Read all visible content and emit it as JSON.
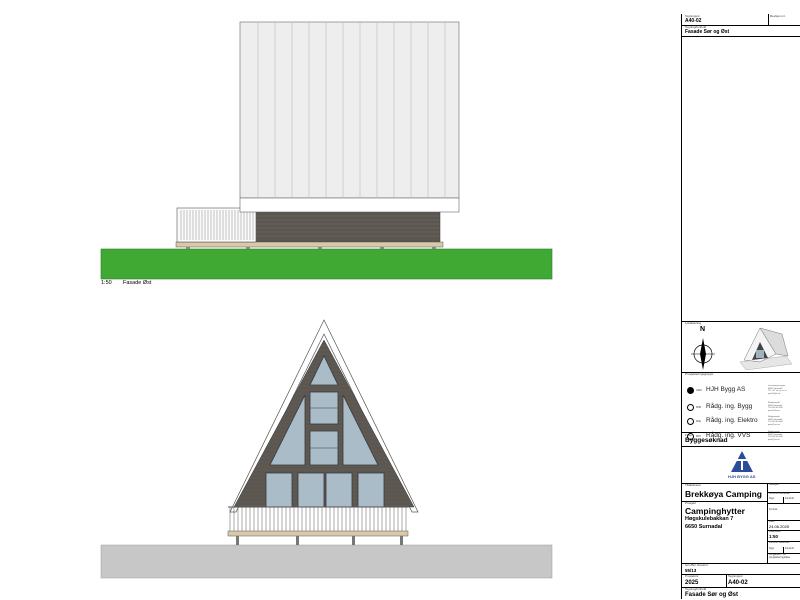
{
  "views": {
    "east": {
      "scale": "1:50",
      "title": "Fasade Øst"
    }
  },
  "title_block": {
    "top": {
      "sheet_label": "Tegningsnr.",
      "sheet_no": "A40-02",
      "revision_label": "Revisjon nr.",
      "title_label": "Tegning/Innhold",
      "title_value": "Fasade Sør og Øst"
    },
    "north_label": "Lokalisering",
    "north_letter": "N",
    "consultants_label": "Prosjekteringsgruppe",
    "consultants": [
      {
        "name": "HJH Bygg AS",
        "selected": true,
        "icon": "ARK",
        "address": "Lensmannsvegen\n6650 Surnadal\nTlf: +47 xx xx xx xx\npost@hjh.no"
      },
      {
        "name": "Rådg. ing. Bygg",
        "selected": false,
        "icon": "RIB",
        "address": "Rådgivende\n6650 Surnadal\nTlf: 000 00 000\npost@rib.no"
      },
      {
        "name": "Rådg. ing. Elektro",
        "selected": false,
        "icon": "RIE",
        "address": "Rådgivende\n6650 Surnadal\nTlf: 000 00 000\npost@rie.no"
      },
      {
        "name": "Rådg. ing. VVS",
        "selected": false,
        "icon": "RIV",
        "address": "Rådgivende\n6650 Surnadal\nTlf: 000 00 000\npost@riv.no"
      }
    ],
    "phase_label": "Fase",
    "phase_value": "Byggesøknad",
    "logo_text": "HJH BYGG AS",
    "client_label": "Tiltakshaver",
    "client_value": "Brekkøya Camping",
    "project_label": "Prosjekt",
    "project_value": "Campinghytter",
    "address_line1": "Høgskulebakkan 7",
    "address_line2": "6650 Surnadal",
    "right_col": [
      {
        "label": "Godkjent",
        "value": ""
      },
      {
        "label": "Kontroll utførende",
        "value": ""
      },
      {
        "label": "Sign.",
        "value": ""
      },
      {
        "label": "Kontroll",
        "value": ""
      },
      {
        "label": "Format",
        "value": ""
      },
      {
        "label": "Dato",
        "value": "24.06.2025"
      },
      {
        "label": "Målestokk",
        "value": "1:50"
      },
      {
        "label": "Kontroll tilfølende",
        "value": ""
      },
      {
        "label": "Sign.",
        "value": ""
      },
      {
        "label": "Kontroll",
        "value": ""
      },
      {
        "label": "Forgjelder - for prosjekteringsfase",
        "value": ""
      }
    ],
    "gnr_label": "Gnr./Bnr./Festenr.",
    "gnr_value": "55/13",
    "project_no_label": "Prosjektnr.",
    "project_no_value": "2025",
    "drawing_no_label": "Tegningsnr.",
    "drawing_no_value": "A40-02",
    "bottom_title_label": "Tegning/Innhold",
    "bottom_title_value": "Fasade Sør og Øst"
  },
  "colors": {
    "grass": "#3fa934",
    "ground": "#c7c7c7",
    "roof": "#eeeeee",
    "wall": "#5c5651",
    "glass": "#a9bcc8",
    "logo": "#2b4c9b"
  }
}
